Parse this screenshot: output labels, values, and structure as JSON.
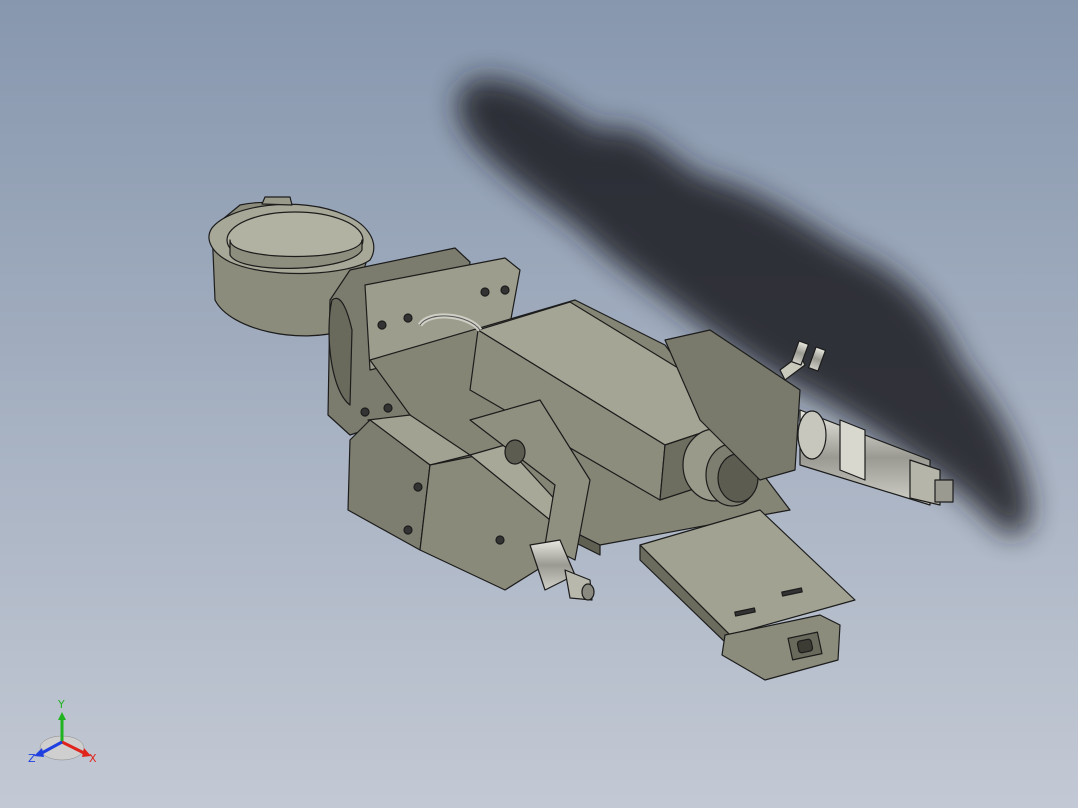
{
  "viewport": {
    "background_top": "#8797ae",
    "background_bottom": "#c3c9d4",
    "part_color": "#8a8a7a",
    "part_dark": "#5c5c50",
    "part_light": "#b5b5a5",
    "edge_color": "#1c1c1c",
    "shadow_color": "#1a1d22"
  },
  "triad": {
    "x_label": "X",
    "y_label": "Y",
    "z_label": "Z",
    "x_color": "#e0241b",
    "y_color": "#1fb31f",
    "z_color": "#1f3fe0"
  }
}
